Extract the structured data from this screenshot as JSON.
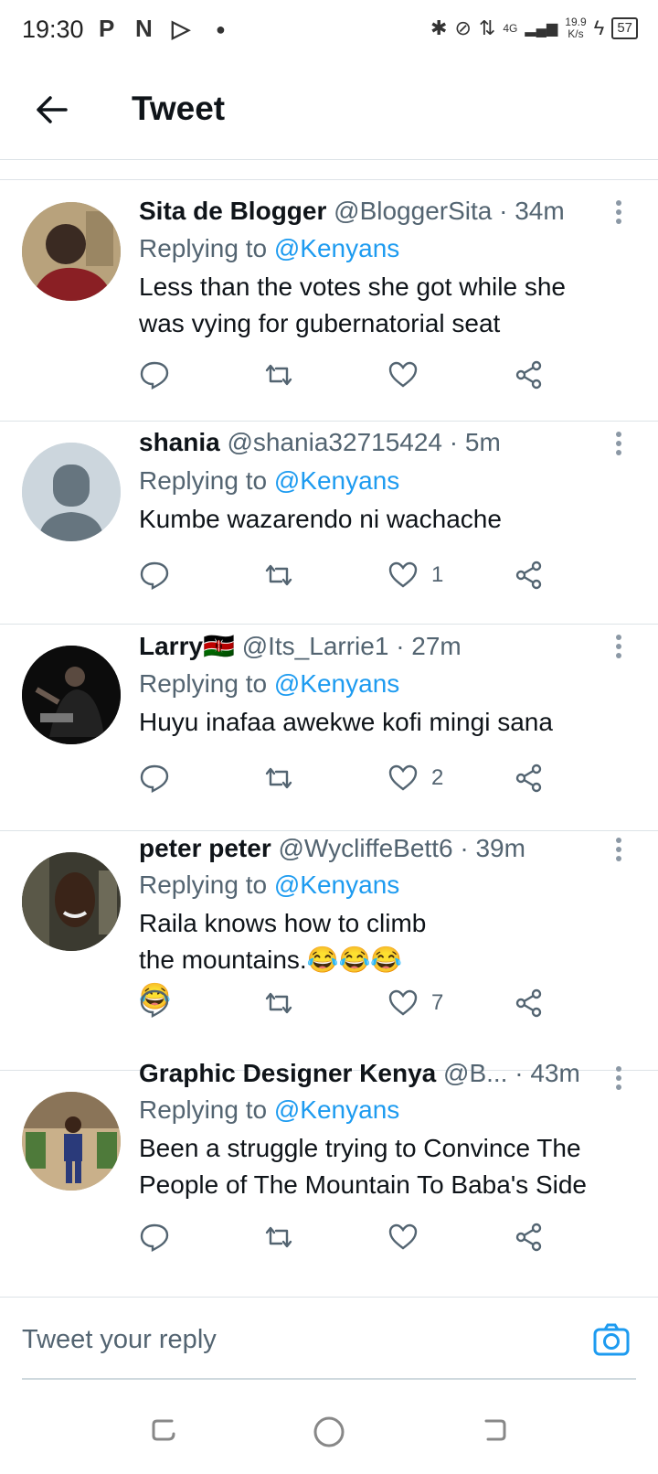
{
  "status_bar": {
    "time": "19:30",
    "network": "4G",
    "speed_value": "19.9",
    "speed_unit": "K/s",
    "battery": "57"
  },
  "header": {
    "title": "Tweet"
  },
  "tweets": [
    {
      "name": "Sita de Blogger",
      "handle": "@BloggerSita",
      "time": "· 34m",
      "reply_prefix": "Replying to",
      "reply_to": "@Kenyans",
      "text": "Less than the votes she got while she was vying for gubernatorial seat",
      "like_count": ""
    },
    {
      "name": "shania",
      "handle": "@shania32715424",
      "time": "· 5m",
      "reply_prefix": "Replying to",
      "reply_to": "@Kenyans",
      "text": "Kumbe wazarendo ni wachache",
      "like_count": "1"
    },
    {
      "name": "Larry🇰🇪",
      "handle": "@Its_Larrie1",
      "time": "· 27m",
      "reply_prefix": "Replying to",
      "reply_to": "@Kenyans",
      "text": "Huyu inafaa awekwe kofi mingi sana",
      "like_count": "2"
    },
    {
      "name": "peter peter",
      "handle": "@WycliffeBett6",
      "time": "· 39m",
      "reply_prefix": "Replying to",
      "reply_to": "@Kenyans",
      "text": "Raila knows how to climb the mountains.😂😂😂😂",
      "like_count": "7"
    },
    {
      "name": "Graphic Designer Kenya",
      "handle": "@B...",
      "time": "· 43m",
      "reply_prefix": "Replying to",
      "reply_to": "@Kenyans",
      "text": "Been a struggle trying to Convince The People of The Mountain To Baba's Side",
      "like_count": ""
    }
  ],
  "compose": {
    "placeholder": "Tweet your reply"
  },
  "colors": {
    "accent": "#1d9bf0",
    "muted": "#536471",
    "divider": "#dde3e7"
  }
}
